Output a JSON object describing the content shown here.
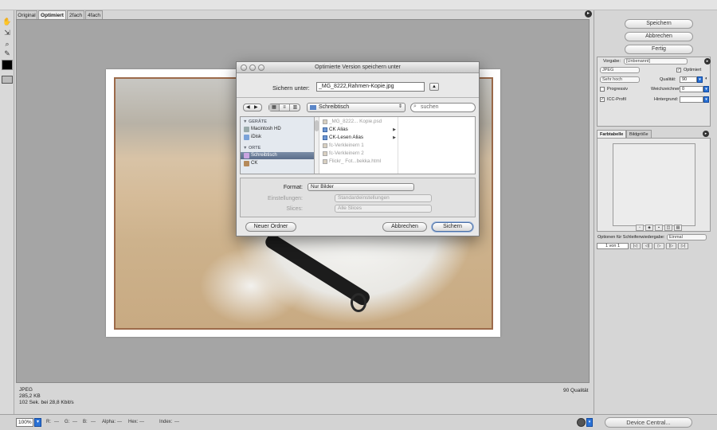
{
  "tabs": [
    {
      "label": "Original"
    },
    {
      "label": "Optimiert",
      "active": true
    },
    {
      "label": "2fach"
    },
    {
      "label": "4fach"
    }
  ],
  "tabs_menu_icon": "circle-arrow-icon",
  "tools": [
    "hand-icon",
    "slice-select-icon",
    "zoom-icon",
    "eyedropper-icon"
  ],
  "status": {
    "format": "JPEG",
    "size": "285,2 KB",
    "time": "102 Sek. bei 28,8 Kbit/s",
    "quality": "90 Qualität"
  },
  "bottom": {
    "zoom": "100%",
    "r": "R:",
    "r_val": "---",
    "g": "G:",
    "g_val": "---",
    "b": "B:",
    "b_val": "---",
    "alpha": "Alpha:",
    "alpha_val": "---",
    "hex": "Hex:",
    "hex_val": "---",
    "index": "Index:",
    "index_val": "---",
    "device_central": "Device Central..."
  },
  "right": {
    "save": "Speichern",
    "cancel": "Abbrechen",
    "done": "Fertig",
    "preset_label": "Vorgabe:",
    "preset_value": "[Unbenannt]",
    "format_value": "JPEG",
    "quality_level": "Sehr hoch",
    "optimized_label": "Optimiert",
    "quality_label": "Qualität:",
    "quality_value": "90",
    "progressive_label": "Progressiv",
    "blur_label": "Weichzeichnen:",
    "blur_value": "0",
    "icc_label": "ICC-Profil",
    "matte_label": "Hintergrund:",
    "tab_colortable": "Farbtabelle",
    "tab_imagesize": "Bildgröße",
    "loop_label": "Optionen für Schleifenwiedergabe:",
    "loop_value": "Einmal",
    "frame_counter": "1 von 1"
  },
  "dialog": {
    "title": "Optimierte Version speichern unter",
    "save_as_label": "Sichern unter:",
    "filename": "_MG_8222,Rahmen-Kopie.jpg",
    "location": "Schreibtisch",
    "search_placeholder": "suchen",
    "sidebar": {
      "devices_header": "▼ GERÄTE",
      "places_header": "▼ ORTE",
      "items": [
        "Macintosh HD",
        "iDisk",
        "Schreibtisch",
        "CK"
      ]
    },
    "files": [
      {
        "name": "_MG_8222... Kopie.psd",
        "dim": true
      },
      {
        "name": "CK Alias",
        "alias": true,
        "chevron": true
      },
      {
        "name": "CK-Lesen Alias",
        "alias": true,
        "chevron": true
      },
      {
        "name": "fc-Verkleinern 1",
        "dim": true
      },
      {
        "name": "fc-Verkleinern 2",
        "dim": true
      },
      {
        "name": "Flickr_ Fot...bekka.html",
        "dim": true
      }
    ],
    "format_label": "Format:",
    "format_value": "Nur Bilder",
    "settings_label": "Einstellungen:",
    "settings_value": "Standardeinstellungen",
    "slices_label": "Slices:",
    "slices_value": "Alle Slices",
    "new_folder": "Neuer Ordner",
    "cancel": "Abbrechen",
    "save": "Sichern"
  }
}
